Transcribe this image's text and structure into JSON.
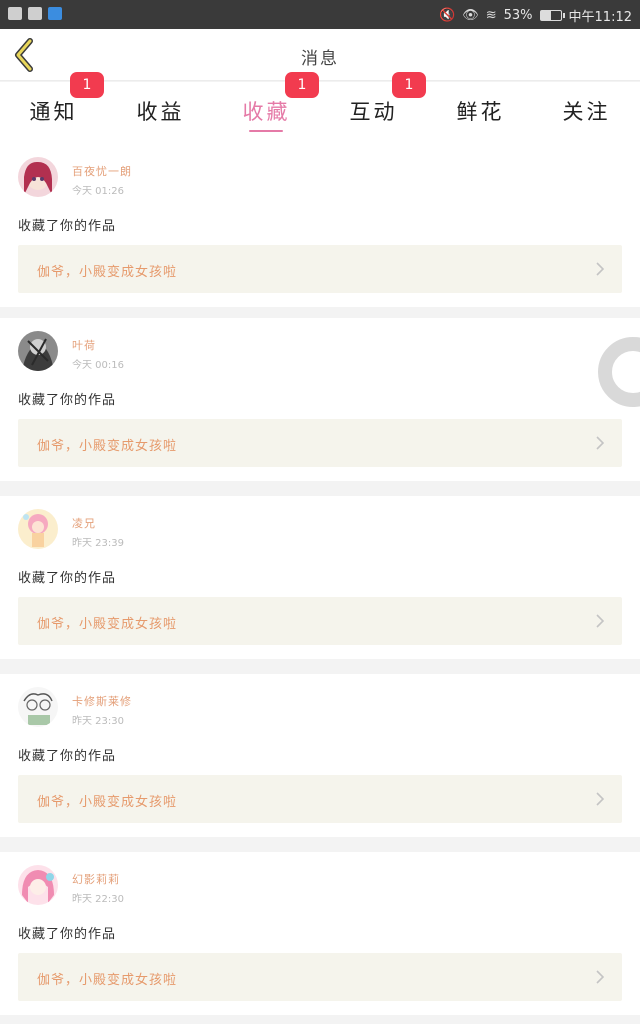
{
  "status_bar": {
    "left_icons": [
      "app-icon",
      "app-icon",
      "browser-icon"
    ],
    "battery_percent": "53%",
    "battery_level": 0.53,
    "time": "中午11:12"
  },
  "header": {
    "title": "消息",
    "back_icon": "chevron-left-icon"
  },
  "tabs": [
    {
      "label": "通知",
      "badge": "1",
      "active": false
    },
    {
      "label": "收益",
      "badge": "",
      "active": false
    },
    {
      "label": "收藏",
      "badge": "1",
      "active": true
    },
    {
      "label": "互动",
      "badge": "1",
      "active": false
    },
    {
      "label": "鲜花",
      "badge": "",
      "active": false
    },
    {
      "label": "关注",
      "badge": "",
      "active": false
    }
  ],
  "colors": {
    "accent": "#e57aa7",
    "badge": "#f23b4f",
    "username": "#e4a07a",
    "work_title": "#e69a6c"
  },
  "feed": [
    {
      "user": "百夜忧一朗",
      "time": "今天 01:26",
      "action": "收藏了你的作品",
      "work": "伽爷，小殿变成女孩啦"
    },
    {
      "user": "叶荷",
      "time": "今天 00:16",
      "action": "收藏了你的作品",
      "work": "伽爷，小殿变成女孩啦"
    },
    {
      "user": "凌兄",
      "time": "昨天 23:39",
      "action": "收藏了你的作品",
      "work": "伽爷，小殿变成女孩啦"
    },
    {
      "user": "卡修斯莱修",
      "time": "昨天 23:30",
      "action": "收藏了你的作品",
      "work": "伽爷，小殿变成女孩啦"
    },
    {
      "user": "幻影莉莉",
      "time": "昨天 22:30",
      "action": "收藏了你的作品",
      "work": "伽爷，小殿变成女孩啦"
    }
  ]
}
